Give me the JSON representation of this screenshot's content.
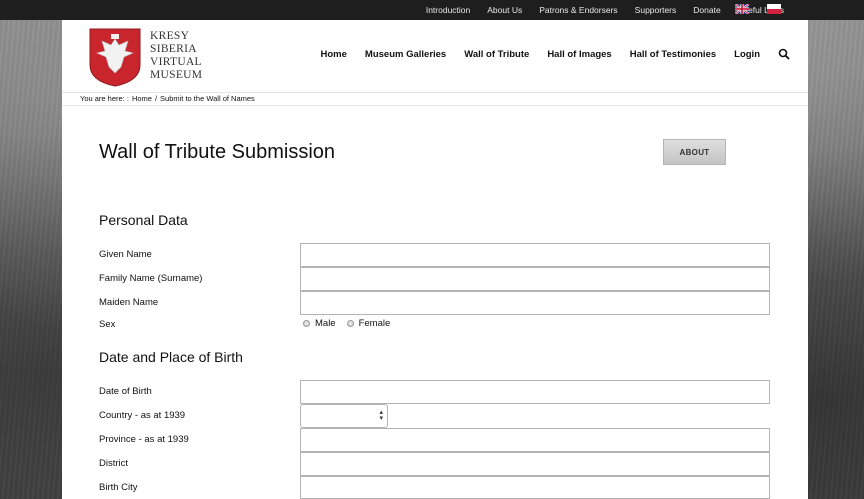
{
  "topbar": {
    "links": [
      "Introduction",
      "About Us",
      "Patrons & Endorsers",
      "Supporters",
      "Donate",
      "Useful Links"
    ],
    "flags": [
      "uk-flag-icon",
      "poland-flag-icon"
    ]
  },
  "logo": {
    "lines": [
      "KRESY",
      "SIBERIA",
      "VIRTUAL",
      "MUSEUM"
    ],
    "icon": "polish-eagle-shield-icon"
  },
  "mainnav": {
    "items": [
      "Home",
      "Museum Galleries",
      "Wall of Tribute",
      "Hall of Images",
      "Hall of Testimonies",
      "Login"
    ],
    "search_icon": "search-icon"
  },
  "breadcrumb": {
    "prefix": "You are here: :",
    "home": "Home",
    "separator": "/",
    "current": "Submit to the Wall of Names"
  },
  "page": {
    "title": "Wall of Tribute Submission",
    "about_button": "ABOUT"
  },
  "sections": {
    "personal": "Personal Data",
    "birth": "Date and Place of Birth"
  },
  "fields": {
    "given_name": {
      "label": "Given Name",
      "value": ""
    },
    "family_name": {
      "label": "Family Name (Surname)",
      "value": ""
    },
    "maiden_name": {
      "label": "Maiden Name",
      "value": ""
    },
    "sex": {
      "label": "Sex",
      "options": [
        "Male",
        "Female"
      ]
    },
    "date_of_birth": {
      "label": "Date of Birth",
      "value": ""
    },
    "country": {
      "label": "Country - as at 1939",
      "selected": ""
    },
    "province": {
      "label": "Province - as at 1939",
      "value": ""
    },
    "district": {
      "label": "District",
      "value": ""
    },
    "birth_city": {
      "label": "Birth City",
      "value": ""
    }
  },
  "colors": {
    "topbar": "#1e1e1e",
    "page_bg": "#ffffff",
    "shield_red": "#c8262c"
  }
}
